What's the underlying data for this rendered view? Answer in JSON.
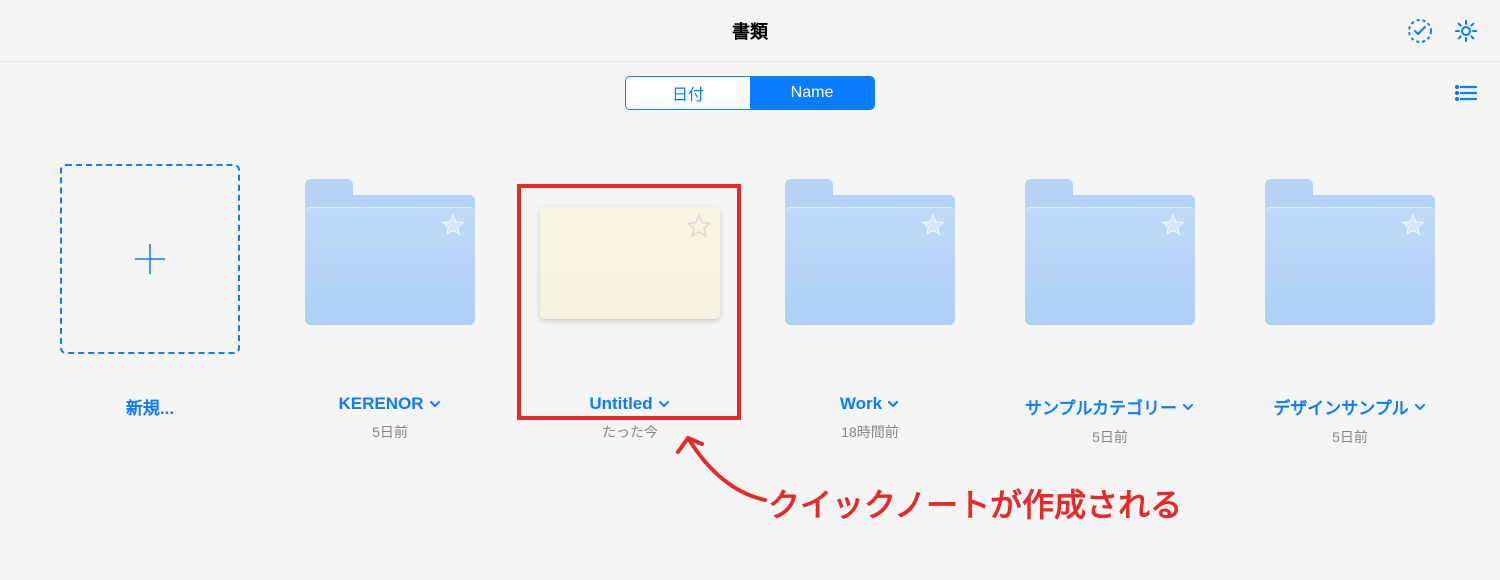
{
  "header": {
    "title": "書類"
  },
  "segmented": {
    "date_label": "日付",
    "name_label": "Name",
    "active": "name"
  },
  "items": [
    {
      "type": "new",
      "title": "新規...",
      "sub": ""
    },
    {
      "type": "folder",
      "title": "KERENOR",
      "sub": "5日前"
    },
    {
      "type": "note",
      "title": "Untitled",
      "sub": "たった今",
      "highlighted": true
    },
    {
      "type": "folder",
      "title": "Work",
      "sub": "18時間前"
    },
    {
      "type": "folder",
      "title": "サンプルカテゴリー",
      "sub": "5日前"
    },
    {
      "type": "folder",
      "title": "デザインサンプル",
      "sub": "5日前"
    }
  ],
  "annotation": {
    "text": "クイックノートが作成される"
  },
  "colors": {
    "accent": "#0a7cff",
    "annotation": "#e52a2a",
    "folder": "#b5d3f5"
  }
}
